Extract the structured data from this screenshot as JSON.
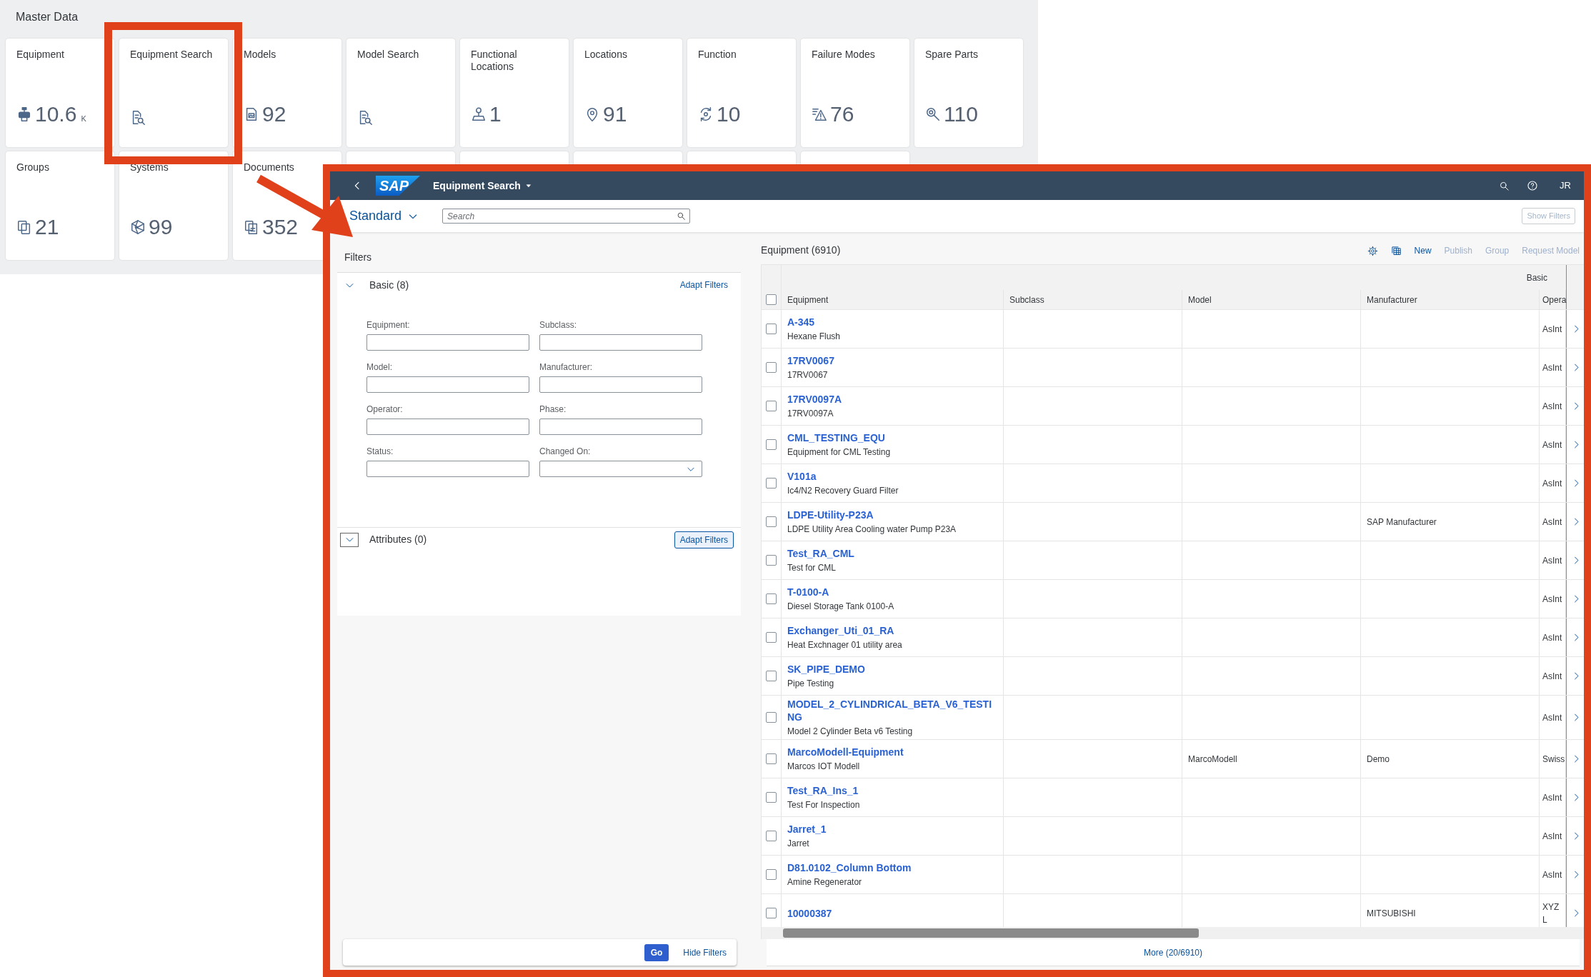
{
  "dashboard": {
    "title": "Master Data",
    "tiles": [
      {
        "kind": "metric",
        "title": "Equipment",
        "value": "10.6",
        "unit": "K"
      },
      {
        "kind": "shortcut",
        "title": "Equipment Search"
      },
      {
        "kind": "metric",
        "title": "Models",
        "value": "92"
      },
      {
        "kind": "shortcut",
        "title": "Model Search"
      },
      {
        "kind": "metric",
        "title": "Functional Locations",
        "value": "1"
      },
      {
        "kind": "metric",
        "title": "Locations",
        "value": "91"
      },
      {
        "kind": "metric",
        "title": "Function",
        "value": "10"
      },
      {
        "kind": "metric",
        "title": "Failure Modes",
        "value": "76"
      },
      {
        "kind": "metric",
        "title": "Spare Parts",
        "value": "110"
      },
      {
        "kind": "metric",
        "title": "Groups",
        "value": "21"
      },
      {
        "kind": "metric",
        "title": "Systems",
        "value": "99"
      },
      {
        "kind": "metric",
        "title": "Documents",
        "value": "352"
      },
      {
        "kind": "blank"
      },
      {
        "kind": "blank"
      },
      {
        "kind": "blank"
      },
      {
        "kind": "blank"
      },
      {
        "kind": "blank"
      }
    ]
  },
  "app": {
    "logo": "SAP",
    "title": "Equipment Search",
    "user_initials": "JR",
    "variant": "Standard",
    "search": {
      "placeholder": "Search"
    },
    "show_filters": "Show Filters",
    "filters": {
      "title": "Filters",
      "groups": [
        {
          "title": "Basic (8)",
          "action": "Adapt Filters",
          "focused": false,
          "fields": [
            {
              "label": "Equipment:",
              "kind": "text"
            },
            {
              "label": "Subclass:",
              "kind": "text"
            },
            {
              "label": "Model:",
              "kind": "text"
            },
            {
              "label": "Manufacturer:",
              "kind": "text"
            },
            {
              "label": "Operator:",
              "kind": "text"
            },
            {
              "label": "Phase:",
              "kind": "text"
            },
            {
              "label": "Status:",
              "kind": "text"
            },
            {
              "label": "Changed On:",
              "kind": "select"
            }
          ]
        },
        {
          "title": "Attributes (0)",
          "action": "Adapt Filters",
          "focused": true
        }
      ],
      "go": "Go",
      "hide": "Hide Filters"
    },
    "table": {
      "title": "Equipment (6910)",
      "actions": [
        {
          "label": "New",
          "disabled": false
        },
        {
          "label": "Publish",
          "disabled": true
        },
        {
          "label": "Group",
          "disabled": true
        },
        {
          "label": "Request Model",
          "disabled": true
        }
      ],
      "group_header": "Basic",
      "columns": [
        "Equipment",
        "Subclass",
        "Model",
        "Manufacturer",
        "Opera"
      ],
      "all_selected": false,
      "rows": [
        {
          "id": "A-345",
          "description": "Hexane Flush",
          "subclass": "",
          "model": "",
          "manufacturer": "",
          "operator": "AsInt",
          "selected": false
        },
        {
          "id": "17RV0067",
          "description": "17RV0067",
          "subclass": "",
          "model": "",
          "manufacturer": "",
          "operator": "AsInt",
          "selected": false
        },
        {
          "id": "17RV0097A",
          "description": "17RV0097A",
          "subclass": "",
          "model": "",
          "manufacturer": "",
          "operator": "AsInt",
          "selected": false
        },
        {
          "id": "CML_TESTING_EQU",
          "description": "Equipment for CML Testing",
          "subclass": "",
          "model": "",
          "manufacturer": "",
          "operator": "AsInt",
          "selected": false
        },
        {
          "id": "V101a",
          "description": "Ic4/N2 Recovery Guard Filter",
          "subclass": "",
          "model": "",
          "manufacturer": "",
          "operator": "AsInt",
          "selected": false
        },
        {
          "id": "LDPE-Utility-P23A",
          "description": "LDPE Utility Area Cooling water Pump P23A",
          "subclass": "",
          "model": "",
          "manufacturer": "SAP Manufacturer",
          "operator": "AsInt",
          "selected": false
        },
        {
          "id": "Test_RA_CML",
          "description": "Test for CML",
          "subclass": "",
          "model": "",
          "manufacturer": "",
          "operator": "AsInt",
          "selected": false
        },
        {
          "id": "T-0100-A",
          "description": "Diesel Storage Tank 0100-A",
          "subclass": "",
          "model": "",
          "manufacturer": "",
          "operator": "AsInt",
          "selected": false
        },
        {
          "id": "Exchanger_Uti_01_RA",
          "description": "Heat Exchnager 01 utility area",
          "subclass": "",
          "model": "",
          "manufacturer": "",
          "operator": "AsInt",
          "selected": false
        },
        {
          "id": "SK_PIPE_DEMO",
          "description": "Pipe Testing",
          "subclass": "",
          "model": "",
          "manufacturer": "",
          "operator": "AsInt",
          "selected": false
        },
        {
          "id": "MODEL_2_CYLINDRICAL_BETA_V6_TESTING",
          "description": "Model 2 Cylinder Beta v6 Testing",
          "subclass": "",
          "model": "",
          "manufacturer": "",
          "operator": "AsInt",
          "selected": false
        },
        {
          "id": "MarcoModell-Equipment",
          "description": "Marcos IOT Modell",
          "subclass": "",
          "model": "MarcoModell",
          "manufacturer": "Demo",
          "operator": "Swiss",
          "selected": false
        },
        {
          "id": "Test_RA_Ins_1",
          "description": "Test For Inspection",
          "subclass": "",
          "model": "",
          "manufacturer": "",
          "operator": "AsInt",
          "selected": false
        },
        {
          "id": "Jarret_1",
          "description": "Jarret",
          "subclass": "",
          "model": "",
          "manufacturer": "",
          "operator": "AsInt",
          "selected": false
        },
        {
          "id": "D81.0102_Column Bottom",
          "description": "Amine Regenerator",
          "subclass": "",
          "model": "",
          "manufacturer": "",
          "operator": "AsInt",
          "selected": false
        },
        {
          "id": "10000387",
          "subclass": "",
          "model": "",
          "manufacturer": "MITSUBISHI",
          "operator": "XYZ L",
          "selected": false
        }
      ],
      "more": "More (20/6910)"
    }
  }
}
